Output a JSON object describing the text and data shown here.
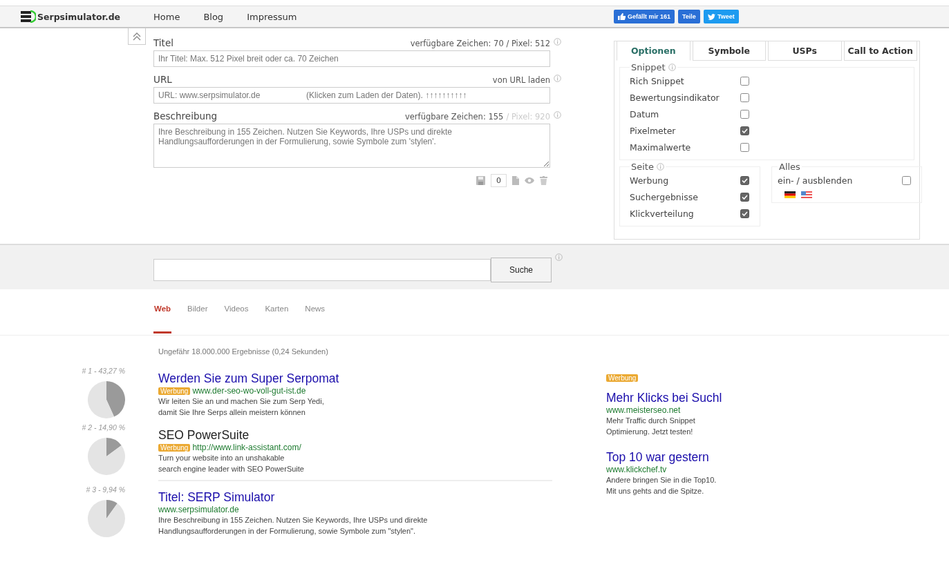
{
  "header": {
    "logo": "Serpsimulator.de",
    "nav": [
      {
        "label": "Home"
      },
      {
        "label": "Blog"
      },
      {
        "label": "Impressum"
      }
    ],
    "social": [
      {
        "kind": "like",
        "label": "Gefällt mir 161"
      },
      {
        "kind": "share",
        "label": "Teile"
      },
      {
        "kind": "tweet",
        "label": "Tweet"
      }
    ]
  },
  "editor": {
    "fields": [
      {
        "kind": "input",
        "label": "Titel",
        "meta": "verfügbare Zeichen: 70 / Pixel: 512",
        "placeholder": "Ihr Titel: Max. 512 Pixel breit oder ca. 70 Zeichen"
      },
      {
        "kind": "input",
        "label": "URL",
        "meta": "von URL laden",
        "placeholder": "URL: www.serpsimulator.de                    (Klicken zum Laden der Daten). ↑↑↑↑↑↑↑↑↑↑"
      },
      {
        "kind": "textarea",
        "label": "Beschreibung",
        "meta": "verfügbare Zeichen: 155",
        "meta_muted": "/ Pixel: 920",
        "placeholder": "Ihre Beschreibung in 155 Zeichen. Nutzen Sie Keywords, Ihre USPs und direkte Handlungsaufforderungen in der Formulierung, sowie Symbole zum 'stylen'."
      }
    ],
    "counter": "0"
  },
  "options": {
    "tabs": [
      {
        "label": "Optionen",
        "selected": true
      },
      {
        "label": "Symbole",
        "selected": false
      },
      {
        "label": "USPs",
        "selected": false
      },
      {
        "label": "Call to Action",
        "selected": false
      }
    ],
    "snippet": {
      "legend": "Snippet",
      "items": [
        {
          "label": "Rich Snippet",
          "checked": false
        },
        {
          "label": "Bewertungsindikator",
          "checked": false
        },
        {
          "label": "Datum",
          "checked": false
        },
        {
          "label": "Pixelmeter",
          "checked": true
        },
        {
          "label": "Maximalwerte",
          "checked": false
        }
      ]
    },
    "page": {
      "legend": "Seite",
      "items": [
        {
          "label": "Werbung",
          "checked": true
        },
        {
          "label": "Suchergebnisse",
          "checked": true
        },
        {
          "label": "Klickverteilung",
          "checked": true
        }
      ]
    },
    "all": {
      "legend": "Alles",
      "items": [
        {
          "label": "ein- / ausblenden",
          "checked": false
        }
      ]
    }
  },
  "search": {
    "button": "Suche"
  },
  "verticals": [
    {
      "label": "Web",
      "selected": true
    },
    {
      "label": "Bilder",
      "selected": false
    },
    {
      "label": "Videos",
      "selected": false
    },
    {
      "label": "Karten",
      "selected": false
    },
    {
      "label": "News",
      "selected": false
    }
  ],
  "result_stats": "Ungefähr 18.000.000 Ergebnisse (0,24 Sekunden)",
  "results": [
    {
      "rank": "# 1 - 43,27 %",
      "chart_data": {
        "type": "pie",
        "values": [
          43.27,
          56.73
        ]
      },
      "title": "Werden Sie zum Super Serpomat",
      "visited": false,
      "ad_label": "Werbung",
      "url": "www.der-seo-wo-voll-gut-ist.de",
      "description": "Wir leiten Sie an und machen Sie zum Serp Yedi,\ndamit Sie Ihre Serps allein meistern können"
    },
    {
      "rank": "# 2 - 14,90 %",
      "chart_data": {
        "type": "pie",
        "values": [
          14.9,
          85.1
        ]
      },
      "title": "SEO PowerSuite",
      "visited": true,
      "ad_label": "Werbung",
      "url": "http://www.link-assistant.com/",
      "description": "Turn your website into an unshakable\nsearch engine leader with SEO PowerSuite"
    },
    {
      "rank": "# 3 - 9,94 %",
      "chart_data": {
        "type": "pie",
        "values": [
          9.94,
          90.06
        ]
      },
      "title": "Titel: SERP Simulator",
      "visited": false,
      "url": "www.serpsimulator.de",
      "description": "Ihre Beschreibung in 155 Zeichen. Nutzen Sie Keywords, Ihre USPs und direkte\nHandlungsaufforderungen in der Formulierung, sowie Symbole zum \"stylen\"."
    }
  ],
  "ads": {
    "label": "Werbung",
    "items": [
      {
        "title": "Mehr Klicks bei Suchl",
        "url": "www.meisterseo.net",
        "description": "Mehr Traffic durch Snippet\nOptimierung. Jetzt testen!"
      },
      {
        "title": "Top 10 war gestern",
        "url": "www.klickchef.tv",
        "description": "Andere bringen Sie in die Top10.\nMit uns gehts and die Spitze."
      }
    ]
  }
}
